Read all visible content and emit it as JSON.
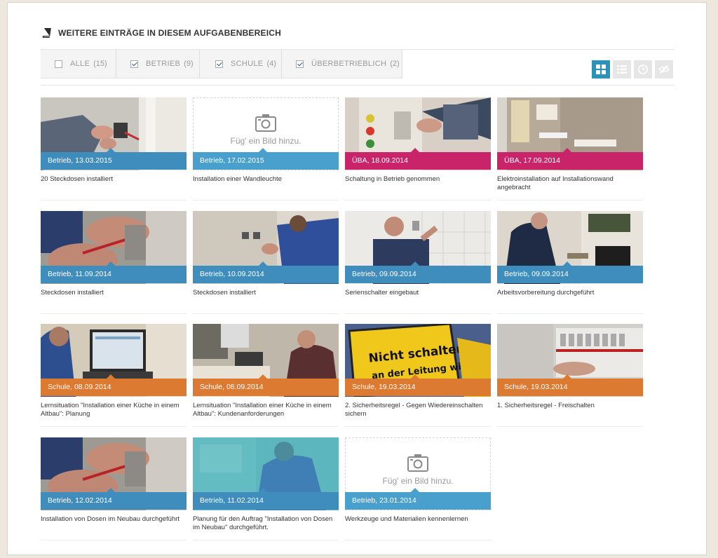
{
  "section": {
    "title": "WEITERE EINTRÄGE IN DIESEM AUFGABENBEREICH",
    "icon": "book-icon"
  },
  "filters": [
    {
      "label": "ALLE",
      "count": "(15)",
      "checked": false
    },
    {
      "label": "BETRIEB",
      "count": "(9)",
      "checked": true
    },
    {
      "label": "SCHULE",
      "count": "(4)",
      "checked": true
    },
    {
      "label": "ÜBERBETRIEBLICH",
      "count": "(2)",
      "checked": true
    }
  ],
  "view_buttons": [
    {
      "icon": "grid-view-icon",
      "active": true
    },
    {
      "icon": "list-view-icon",
      "active": false
    },
    {
      "icon": "clock-icon",
      "active": false
    },
    {
      "icon": "hide-eye-icon",
      "active": false
    }
  ],
  "colors": {
    "betrieb": "#3f8dbd",
    "schule": "#dd7a31",
    "ueba": "#c9246a",
    "accent": "#2c92b7"
  },
  "placeholder_text": "Füg' ein Bild hinzu.",
  "entries": [
    {
      "band": "Betrieb, 13.03.2015",
      "category": "betrieb",
      "caption": "20 Steckdosen installiert",
      "image": "photo-hands-socket"
    },
    {
      "band": "Betrieb, 17.02.2015",
      "category": "betrieb",
      "caption": "Installation einer Wandleuchte",
      "image": "placeholder"
    },
    {
      "band": "ÜBA, 18.09.2014",
      "category": "ueba",
      "caption": "Schaltung in Betrieb genommen",
      "image": "photo-training-board"
    },
    {
      "band": "ÜBA, 17.09.2014",
      "category": "ueba",
      "caption": "Elektroinstallation auf Installationswand angebracht",
      "image": "photo-installation-wall"
    },
    {
      "band": "Betrieb, 11.09.2014",
      "category": "betrieb",
      "caption": "Steckdosen installiert",
      "image": "photo-wiring-closeup"
    },
    {
      "band": "Betrieb, 10.09.2014",
      "category": "betrieb",
      "caption": "Steckdosen installiert",
      "image": "photo-worker-kneeling"
    },
    {
      "band": "Betrieb, 09.09.2014",
      "category": "betrieb",
      "caption": "Serienschalter eingebaut",
      "image": "photo-worker-tiles"
    },
    {
      "band": "Betrieb, 09.09.2014",
      "category": "betrieb",
      "caption": "Arbeitsvorbereitung durchgeführt",
      "image": "photo-worker-room"
    },
    {
      "band": "Schule, 08.09.2014",
      "category": "schule",
      "caption": "Lernsituation \"Installation einer Küche in einem Altbau\": Planung",
      "image": "photo-laptop"
    },
    {
      "band": "Schule, 08.09.2014",
      "category": "schule",
      "caption": "Lernsituation \"Installation einer Küche in einem Altbau\": Kundenanforderungen",
      "image": "photo-desk-phone"
    },
    {
      "band": "Schule, 19.03.2014",
      "category": "schule",
      "caption": "2. Sicherheitsregel - Gegen Wiedereinschalten sichern",
      "image": "photo-warning-sign",
      "sign_line1": "Nicht schalten,",
      "sign_line2": "an der Leitung wird"
    },
    {
      "band": "Schule, 19.03.2014",
      "category": "schule",
      "caption": "1. Sicherheitsregel - Freischalten",
      "image": "photo-breaker-panel"
    },
    {
      "band": "Betrieb, 12.02.2014",
      "category": "betrieb",
      "caption": "Installation von Dosen im Neubau durchgeführt",
      "image": "photo-wiring-closeup"
    },
    {
      "band": "Betrieb, 11.02.2014",
      "category": "betrieb",
      "caption": "Planung für den Auftrag \"Installation von Dosen im Neubau\" durchgeführt.",
      "image": "photo-teal-worker"
    },
    {
      "band": "Betrieb, 23.01.2014",
      "category": "betrieb",
      "caption": "Werkzeuge und Materialien kennenlernen",
      "image": "placeholder"
    }
  ]
}
